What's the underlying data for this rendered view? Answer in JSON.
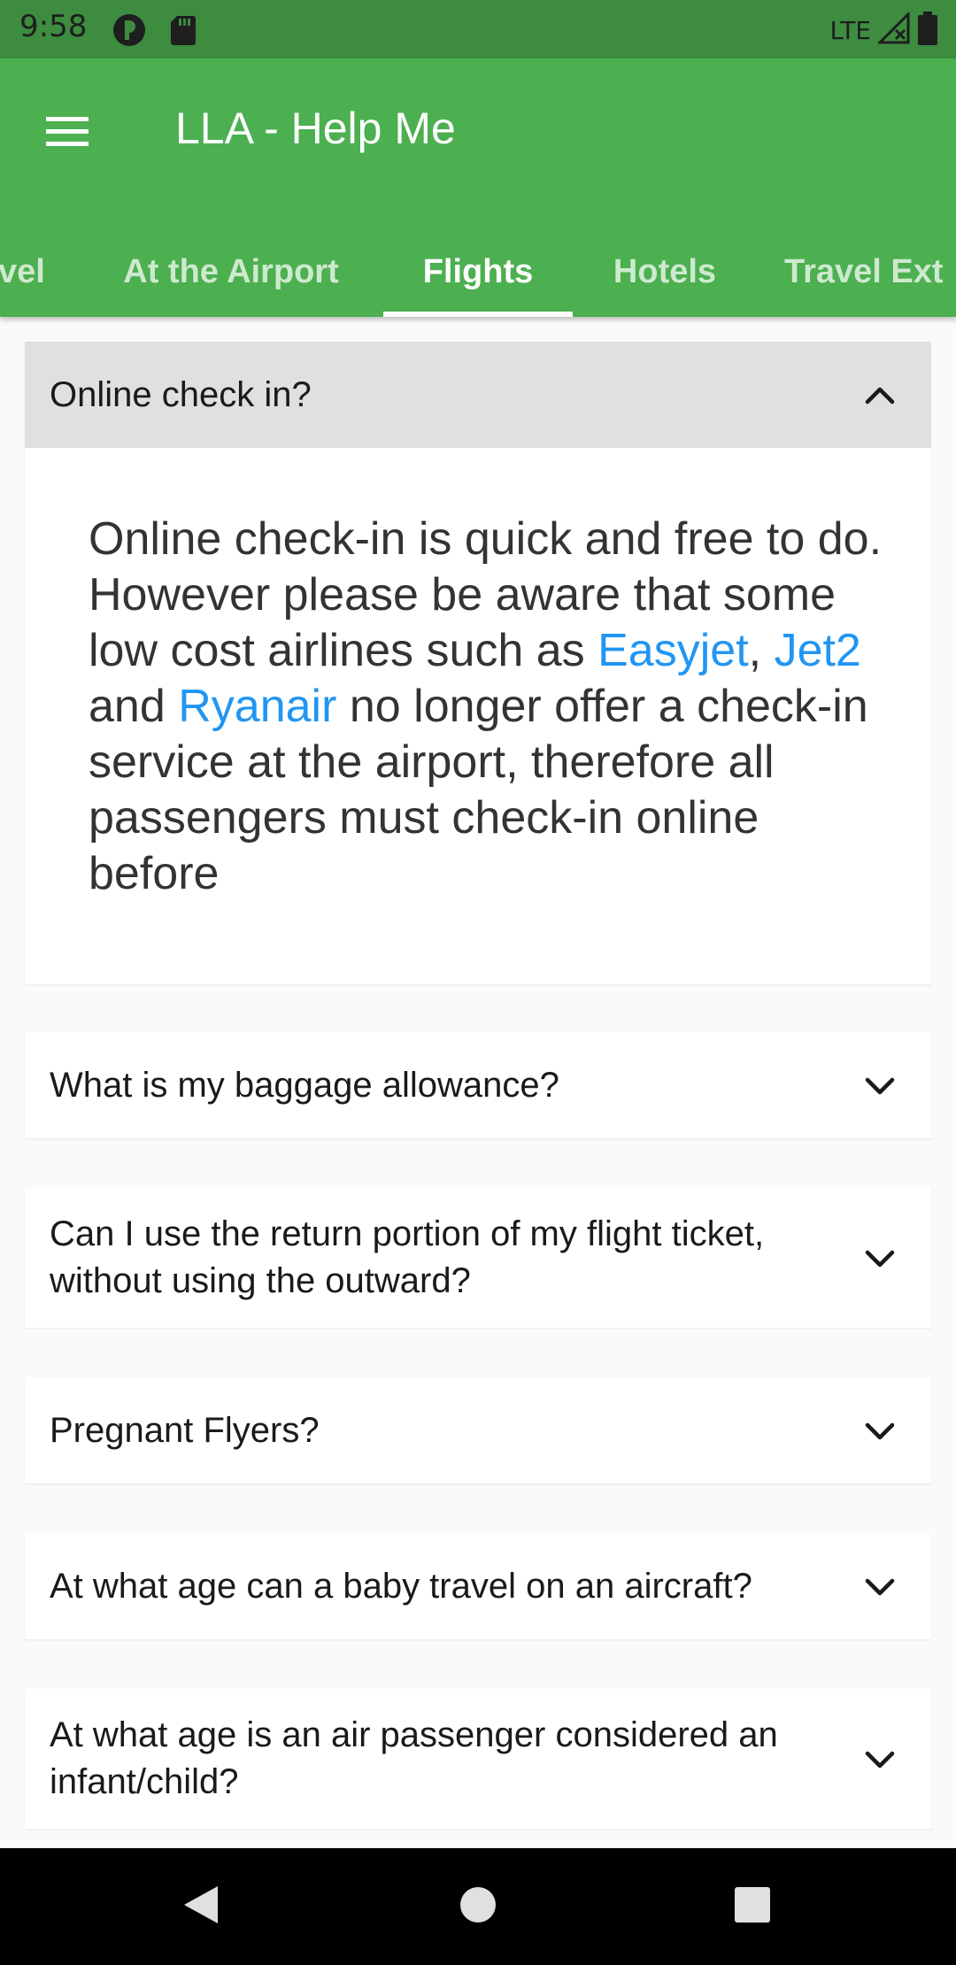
{
  "status_bar": {
    "time": "9:58",
    "network": "LTE",
    "icons": [
      "data-saver-icon",
      "sd-card-icon",
      "signal-icon",
      "battery-icon"
    ]
  },
  "app_bar": {
    "title": "LLA - Help Me",
    "menu_icon": "hamburger-menu-icon",
    "background_color": "#4caf50"
  },
  "tabs": [
    {
      "label": "Travel",
      "visible_text": "vel",
      "active": false
    },
    {
      "label": "At the Airport",
      "active": false
    },
    {
      "label": "Flights",
      "active": true
    },
    {
      "label": "Hotels",
      "active": false
    },
    {
      "label": "Travel Ext",
      "active": false
    }
  ],
  "faq": {
    "expanded": {
      "question": "Online check in?",
      "answer": {
        "line1": "Online check-in is quick and free to do.",
        "line2_pre": "However please be aware that some low cost airlines such as ",
        "link1": "Easyjet",
        "sep1": ", ",
        "link2": "Jet2",
        "sep2": " and ",
        "link3": "Ryanair",
        "line2_post": " no longer offer a check-in service at the airport, therefore all passengers must check-in online before"
      },
      "link_color": "#2196f3"
    },
    "collapsed": [
      {
        "question": "What is my baggage allowance?"
      },
      {
        "question": "Can I use the return portion of my flight ticket, without using the outward?"
      },
      {
        "question": "Pregnant Flyers?"
      },
      {
        "question": "At what age can a baby travel on an aircraft?"
      },
      {
        "question": "At what age is an air passenger considered an infant/child?"
      }
    ]
  },
  "nav_bar": {
    "back": "back-icon",
    "home": "home-icon",
    "recents": "recents-icon"
  }
}
